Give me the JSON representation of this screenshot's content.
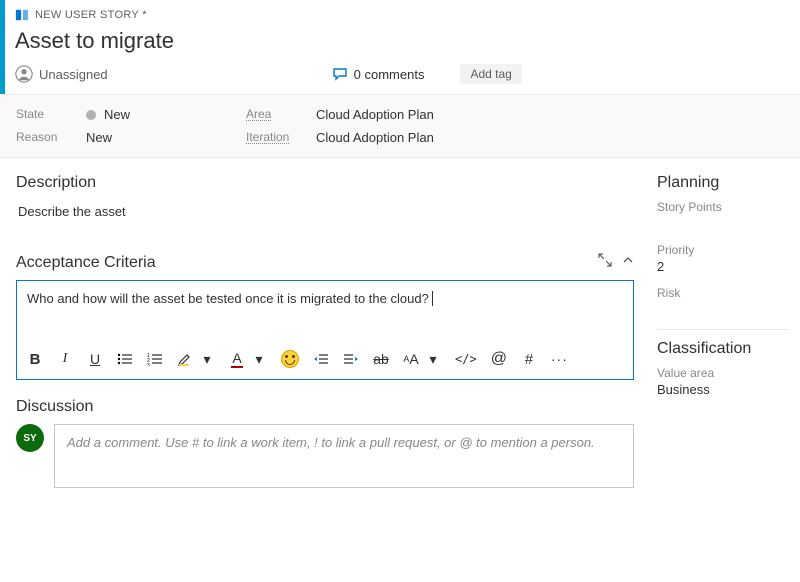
{
  "header": {
    "type_label": "NEW USER STORY *",
    "title": "Asset to migrate",
    "assignee": "Unassigned",
    "comments_count": "0 comments",
    "add_tag": "Add tag"
  },
  "fields": {
    "state_label": "State",
    "state_value": "New",
    "reason_label": "Reason",
    "reason_value": "New",
    "area_label": "Area",
    "area_value": "Cloud Adoption Plan",
    "iteration_label": "Iteration",
    "iteration_value": "Cloud Adoption Plan"
  },
  "sections": {
    "description": {
      "heading": "Description",
      "placeholder": "Describe the asset"
    },
    "acceptance": {
      "heading": "Acceptance Criteria",
      "content": "Who and how will the asset be tested once it is migrated to the cloud?"
    },
    "discussion": {
      "heading": "Discussion",
      "avatar_initials": "SY",
      "placeholder": "Add a comment. Use # to link a work item, ! to link a pull request, or @ to mention a person."
    }
  },
  "sidebar": {
    "planning": {
      "heading": "Planning",
      "story_points_label": "Story Points",
      "priority_label": "Priority",
      "priority_value": "2",
      "risk_label": "Risk"
    },
    "classification": {
      "heading": "Classification",
      "value_area_label": "Value area",
      "value_area_value": "Business"
    }
  },
  "toolbar": {
    "bold": "B",
    "italic": "I",
    "underline": "U",
    "font_color_letter": "A",
    "text_size": "AA",
    "code": "</>",
    "mention": "@",
    "hash": "#",
    "more": "···"
  }
}
